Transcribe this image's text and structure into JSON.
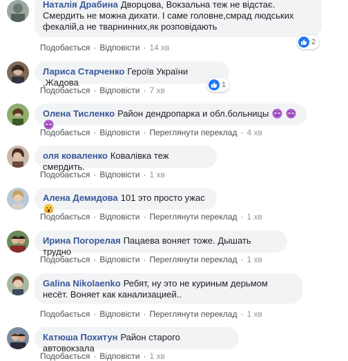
{
  "actions": {
    "like": "Подобається",
    "reply": "Відповісти",
    "see_translation": "Переглянути переклад",
    "separator": "·"
  },
  "comments": [
    {
      "author": "Наталія Драбина",
      "text": "Дворцова, Вокзальна теж не відстає. Смердить не можна дихати. І саме головне,смрад людських фекалій,а не тварнинних,як розповідають",
      "time": "14 хв",
      "reactions": "2"
    },
    {
      "author": "Лариса Старченко",
      "text": "Героїв України ,Жадова",
      "time": "7 хв",
      "reactions": "1"
    },
    {
      "author": "Олена Тисленко",
      "text": "Район дендропарка и обл.больницы",
      "time": "4 хв",
      "emoji": "angry-face-icon"
    },
    {
      "author": "оля коваленко",
      "text": "Ковалівка теж смердить.",
      "time": "1 хв"
    },
    {
      "author": "Алена Демидова",
      "text": "101 это просто ужас",
      "time": "1 хв",
      "emoji": "fearful-face-icon"
    },
    {
      "author": "Ирина Погорелая",
      "text": "Пацаева воняет тоже. Дышать трудно",
      "time": "1 хв"
    },
    {
      "author": "Galina Nikolaenko",
      "text": "Ребят, ну это не куриным дерьмом несёт. Воняет как канализацией..",
      "time": "1 хв"
    },
    {
      "author": "Катюша Похитун",
      "text": "Район старого автовокзала",
      "time": "1 хв"
    }
  ],
  "colors": {
    "author": "#385898",
    "bubble": "#f2f3f5",
    "like_blue": "#2078f4"
  }
}
